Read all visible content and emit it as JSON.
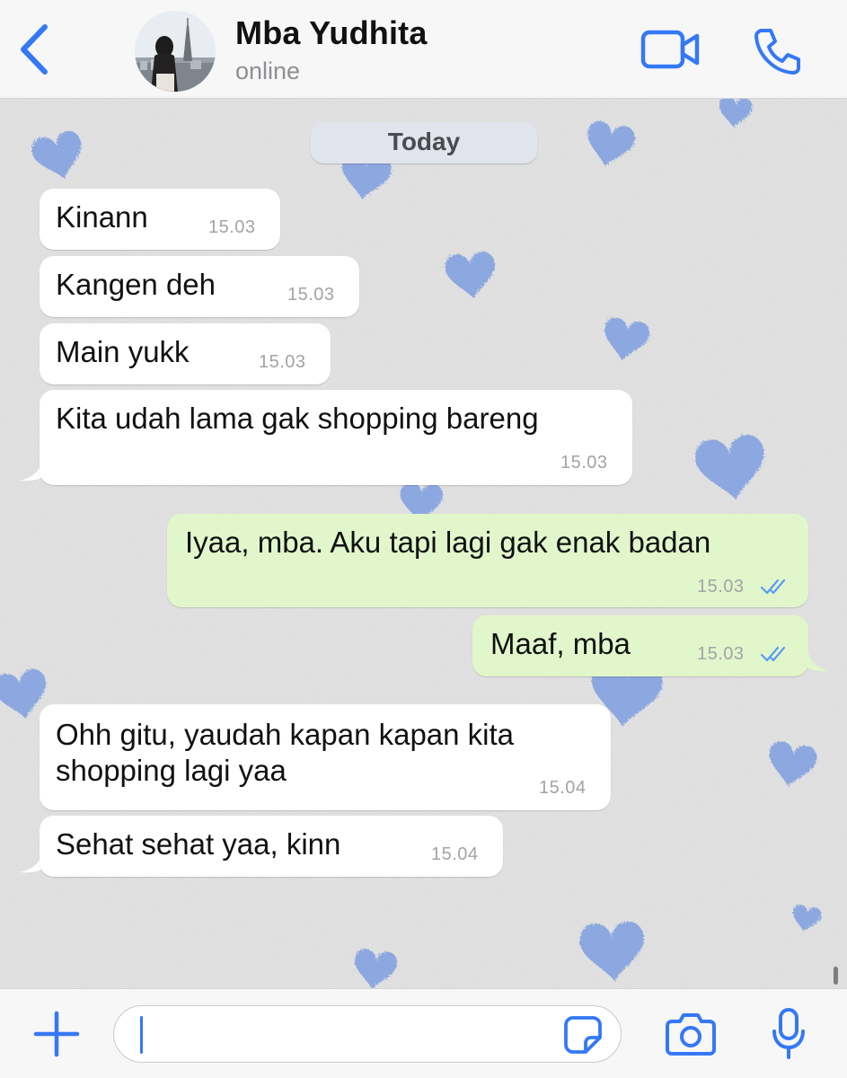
{
  "header": {
    "contact_name": "Mba Yudhita",
    "status": "online",
    "icons": {
      "back": "chevron-left-icon",
      "video": "video-camera-icon",
      "call": "phone-icon"
    }
  },
  "chat": {
    "date_label": "Today",
    "messages": [
      {
        "direction": "in",
        "text": "Kinann",
        "time": "15.03"
      },
      {
        "direction": "in",
        "text": "Kangen deh",
        "time": "15.03"
      },
      {
        "direction": "in",
        "text": "Main yukk",
        "time": "15.03"
      },
      {
        "direction": "in",
        "text": "Kita udah lama gak shopping bareng",
        "time": "15.03"
      },
      {
        "direction": "out",
        "text": "Iyaa, mba. Aku tapi lagi gak enak badan",
        "time": "15.03",
        "read": true
      },
      {
        "direction": "out",
        "text": "Maaf, mba",
        "time": "15.03",
        "read": true
      },
      {
        "direction": "in",
        "text": "Ohh gitu, yaudah kapan kapan kita shopping lagi yaa",
        "time": "15.04"
      },
      {
        "direction": "in",
        "text": "Sehat sehat yaa, kinn",
        "time": "15.04"
      }
    ]
  },
  "input_bar": {
    "message_value": "",
    "placeholder": "",
    "icons": {
      "add": "plus-icon",
      "sticker": "sticker-icon",
      "camera": "camera-icon",
      "mic": "microphone-icon"
    }
  },
  "colors": {
    "accent": "#3478f6",
    "incoming_bubble": "#ffffff",
    "outgoing_bubble": "#e1f7cb",
    "read_ticks": "#5b9bf0",
    "wallpaper_hearts": "#7e9ee0"
  }
}
